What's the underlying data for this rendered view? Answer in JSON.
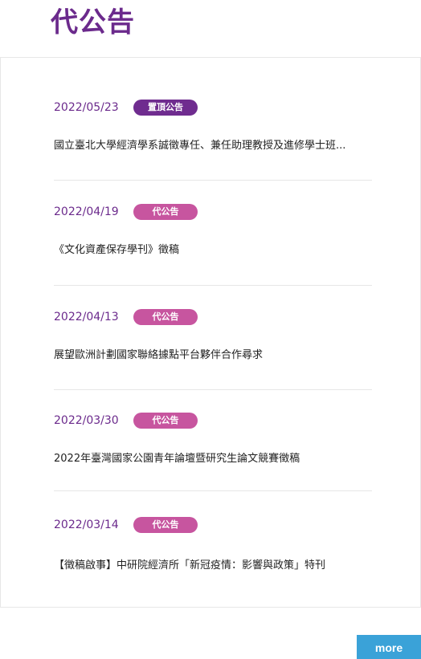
{
  "page": {
    "title": "代公告"
  },
  "announcements": [
    {
      "date": "2022/05/23",
      "badge": "置頂公告",
      "title": "國立臺北大學經濟學系誠徵專任、兼任助理教授及進修學士班..."
    },
    {
      "date": "2022/04/19",
      "badge": "代公告",
      "title": "《文化資產保存學刊》徵稿"
    },
    {
      "date": "2022/04/13",
      "badge": "代公告",
      "title": "展望歐洲計劃國家聯絡據點平台夥伴合作尋求"
    },
    {
      "date": "2022/03/30",
      "badge": "代公告",
      "title": "2022年臺灣國家公園青年論壇暨研究生論文競賽徵稿"
    },
    {
      "date": "2022/03/14",
      "badge": "代公告",
      "title": "【徵稿啟事】中研院經濟所「新冠疫情：影響與政策」特刊"
    }
  ],
  "more_button": {
    "label": "more"
  },
  "colors": {
    "accent": "#6b2a8c",
    "pinned_badge": "#6f2c8f",
    "badge": "#c7559f",
    "more_button": "#3aa2d8"
  }
}
